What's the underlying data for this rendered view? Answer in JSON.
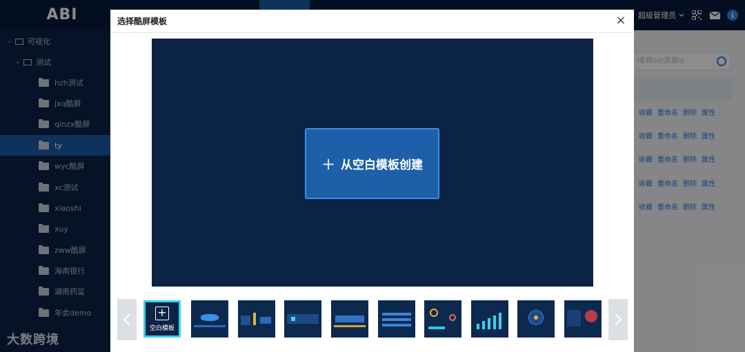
{
  "app": {
    "logo": "ABI"
  },
  "header": {
    "user": "超级管理员",
    "user_chevron": "chevron-down-icon",
    "icons": [
      "qrcode-icon",
      "mail-icon",
      "info-icon"
    ]
  },
  "sidebar": {
    "root": {
      "label": "可视化"
    },
    "group": {
      "label": "测试"
    },
    "items": [
      {
        "label": "hzh测试"
      },
      {
        "label": "jxq酷屏"
      },
      {
        "label": "qinzx酷屏"
      },
      {
        "label": "ty",
        "selected": true
      },
      {
        "label": "wyc酷屏"
      },
      {
        "label": "xc测试"
      },
      {
        "label": "xiaoshi"
      },
      {
        "label": "xuy"
      },
      {
        "label": "zww酷屏"
      },
      {
        "label": "海南银行"
      },
      {
        "label": "湖南药监"
      },
      {
        "label": "年会demo"
      }
    ],
    "watermark": "大数跨境"
  },
  "background": {
    "search_placeholder": "/名称/id/资源id",
    "row_actions": [
      "收藏",
      "重命名",
      "删除",
      "属性"
    ],
    "row_count": 5
  },
  "modal": {
    "title": "选择酷屏模板",
    "create_label": "从空白模板创建",
    "blank_template_label": "空白模板",
    "template_count": 9
  },
  "colors": {
    "accent": "#1a5ca8",
    "highlight": "#2fd2f0",
    "dark_bg": "#0b2443"
  }
}
